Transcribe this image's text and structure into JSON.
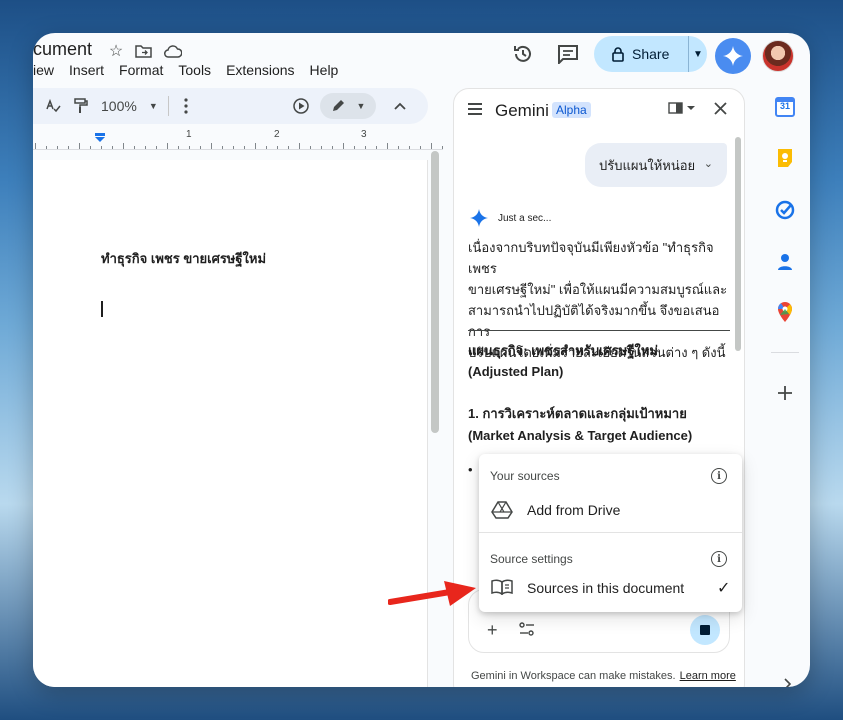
{
  "doc": {
    "title": "cument",
    "menu": [
      "iew",
      "Insert",
      "Format",
      "Tools",
      "Extensions",
      "Help"
    ],
    "zoom": "100%",
    "ruler_numbers": [
      "1",
      "2",
      "3"
    ],
    "body_heading": "ทำธุรกิจ เพชร ขายเศรษฐีใหม่"
  },
  "header": {
    "share_label": "Share"
  },
  "gemini": {
    "title": "Gemini",
    "badge": "Alpha",
    "user_prompt": "ปรับแผนให้หน่อย",
    "status": "Just a sec...",
    "response_intro": [
      "เนื่องจากบริบทปัจจุบันมีเพียงหัวข้อ \"ทำธุรกิจ เพชร",
      "ขายเศรษฐีใหม่\" เพื่อให้แผนมีความสมบูรณ์และ",
      "สามารถนำไปปฏิบัติได้จริงมากขึ้น จึงขอเสนอการ",
      "ปรับแผนโดยเพิ่มรายละเอียดในส่วนต่าง ๆ ดังนี้"
    ],
    "plan_title_th": "แผนธุรกิจ: เพชรสำหรับเศรษฐีใหม่",
    "plan_title_en": "(Adjusted Plan)",
    "section1_th": "1. การวิเคราะห์ตลาดและกลุ่มเป้าหมาย",
    "section1_en": "(Market Analysis & Target Audience)",
    "bullet": "•",
    "disclaimer": "Gemini in Workspace can make mistakes.",
    "learn_more": "Learn more"
  },
  "dropdown": {
    "your_sources": "Your sources",
    "add_from_drive": "Add from Drive",
    "source_settings": "Source settings",
    "sources_in_doc": "Sources in this document",
    "selected_check": "✓"
  },
  "rail": {
    "calendar_day": "31"
  },
  "colors": {
    "accent": "#0b57d0",
    "share_bg": "#c2e7ff",
    "arrow": "#e8261c"
  }
}
